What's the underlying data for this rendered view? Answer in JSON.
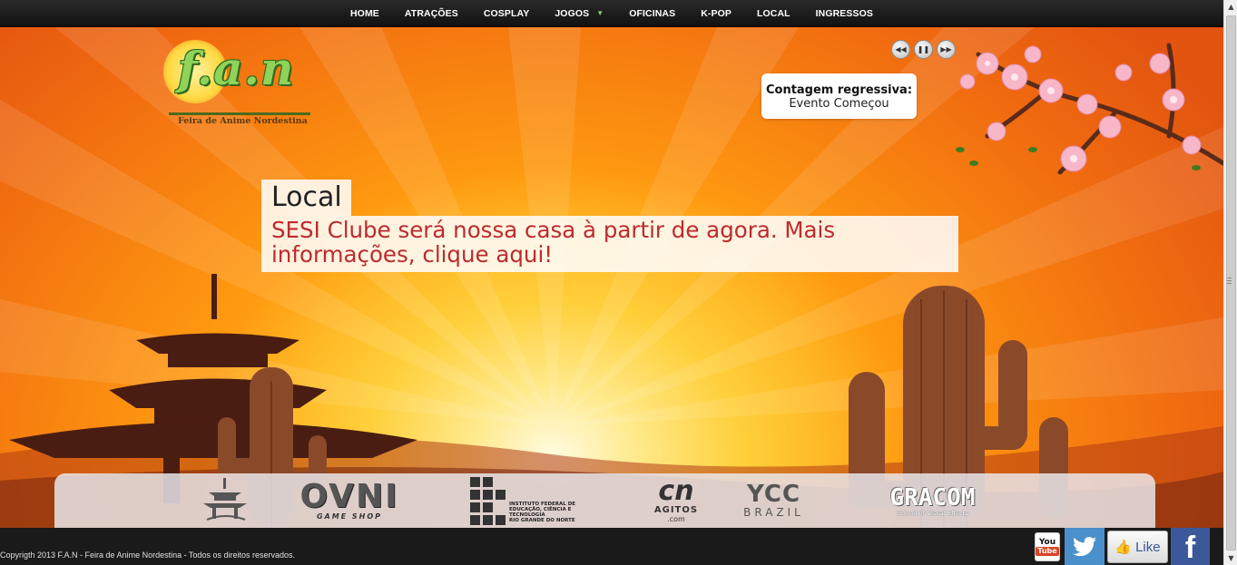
{
  "nav": {
    "items": [
      {
        "label": "HOME"
      },
      {
        "label": "ATRAÇÕES"
      },
      {
        "label": "COSPLAY"
      },
      {
        "label": "JOGOS",
        "has_dropdown": true
      },
      {
        "label": "OFICINAS"
      },
      {
        "label": "K-POP"
      },
      {
        "label": "LOCAL"
      },
      {
        "label": "INGRESSOS"
      }
    ]
  },
  "logo": {
    "word": "f.a.n",
    "subtitle": "Feira de Anime Nordestina"
  },
  "slider": {
    "controls": [
      "prev-icon",
      "pause-icon",
      "next-icon"
    ]
  },
  "countdown": {
    "label": "Contagem regressiva:",
    "value": "Evento Começou"
  },
  "caption": {
    "title": "Local",
    "description": "SESI Clube será nossa casa à partir de agora. Mais informações, clique aqui!"
  },
  "sponsors": {
    "ovni": {
      "name": "OVNI",
      "tagline": "GAME SHOP"
    },
    "ifrn": {
      "lines": [
        "INSTITUTO FEDERAL DE",
        "EDUCAÇÃO, CIÊNCIA E TECNOLOGIA",
        "RIO GRANDE DO NORTE"
      ]
    },
    "agitos": {
      "mark": "cn",
      "name": "AGITOS",
      "suffix": ".com"
    },
    "ycc": {
      "name": "YCC",
      "sub": "BRAZIL"
    },
    "gracom": {
      "name": "GRACOM",
      "tagline": "School of Visual Effects"
    }
  },
  "footer": {
    "copyright": "Copyrigth 2013 F.A.N - Feira de Anime Nordestina - Todos os direitos reservados."
  },
  "social": {
    "youtube": {
      "you": "You",
      "tube": "Tube"
    },
    "like_label": "Like",
    "facebook_glyph": "f"
  },
  "colors": {
    "accent_red": "#bd2a2f",
    "nav_caret": "#7fd36a",
    "twitter": "#4a90cb",
    "facebook": "#3b5998"
  }
}
